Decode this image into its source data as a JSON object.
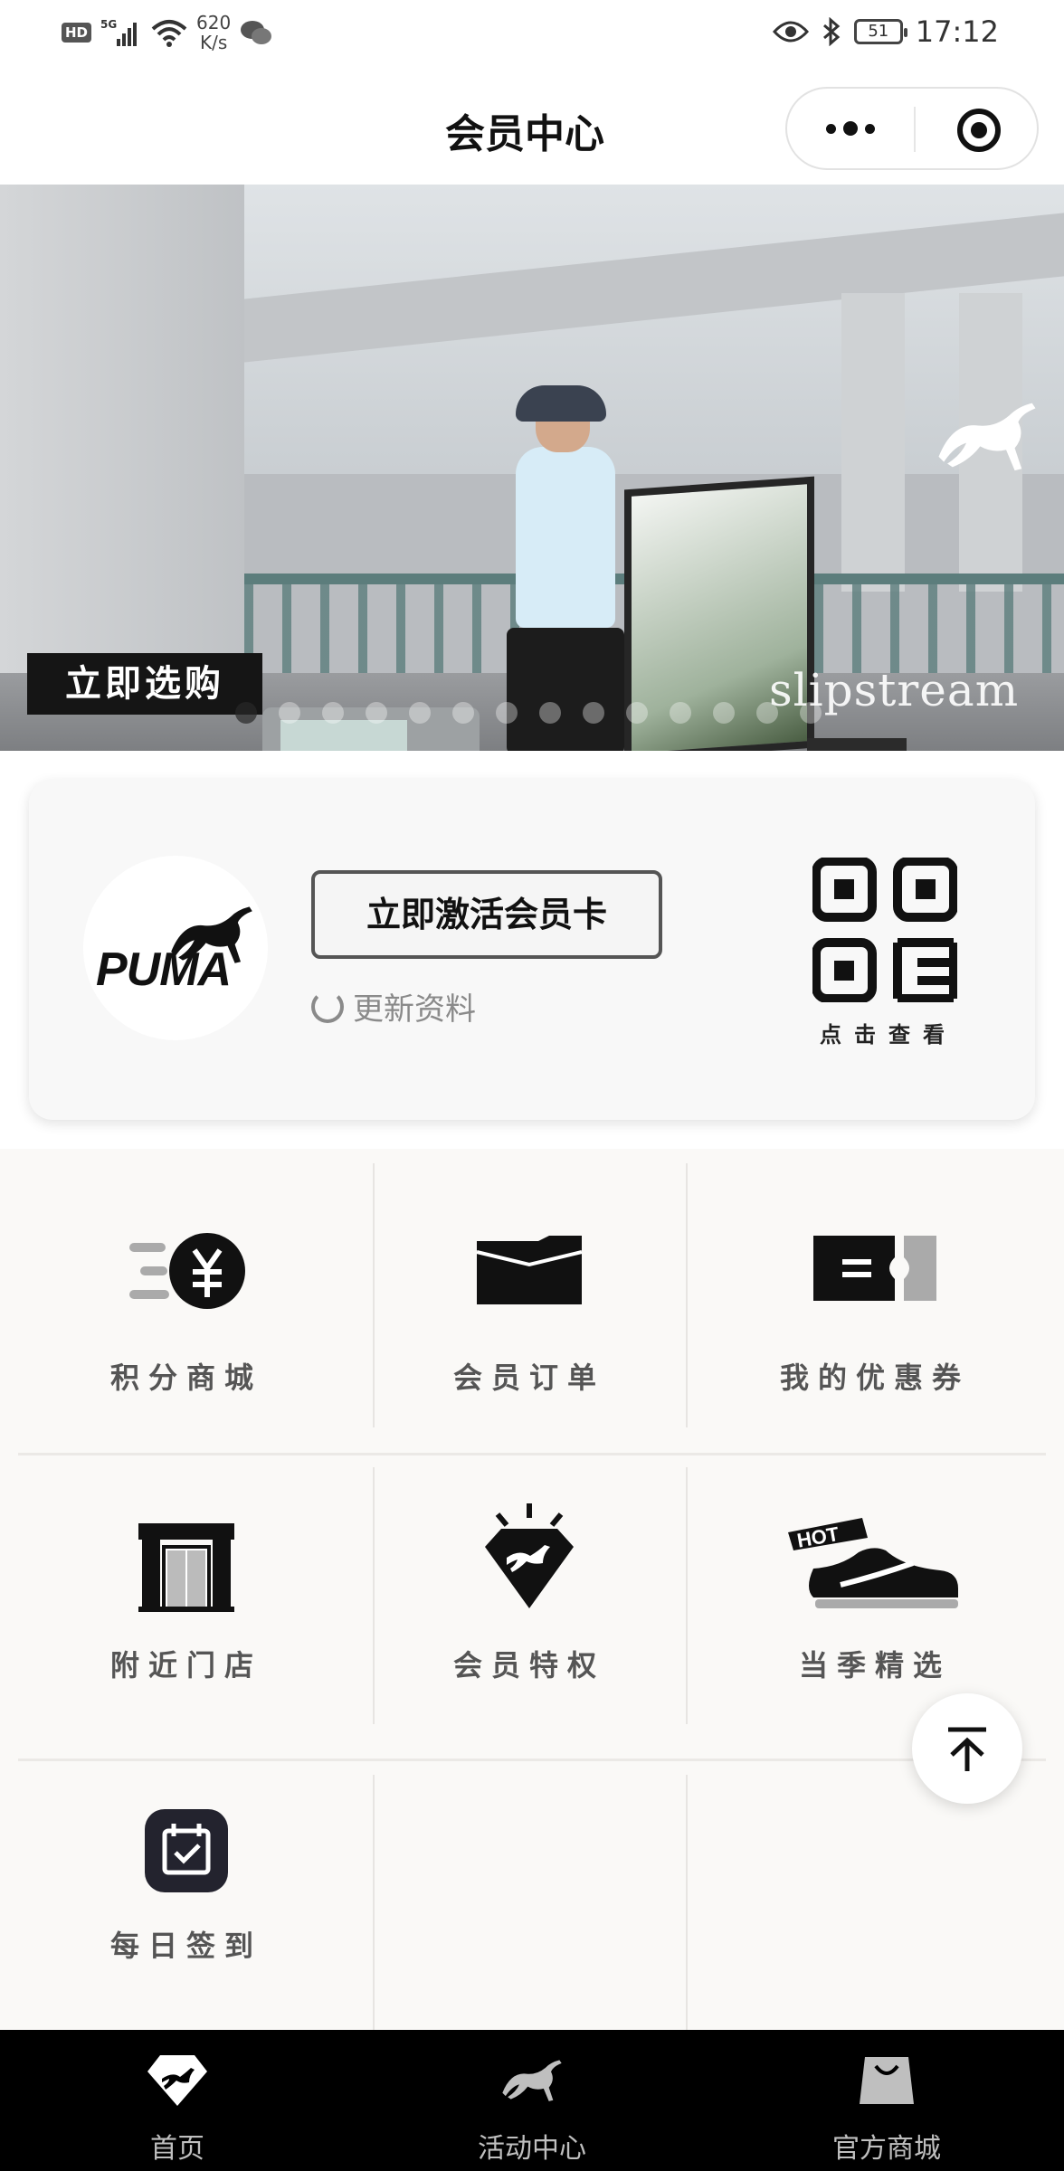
{
  "status_bar": {
    "left_badges": [
      "HD",
      "5G"
    ],
    "net_speed_value": "620",
    "net_speed_unit": "K/s",
    "battery": "51",
    "time": "17:12"
  },
  "title_bar": {
    "title": "会员中心"
  },
  "banner": {
    "shop_now": "立即选购",
    "watermark": "slipstream",
    "slide_count": 14,
    "active_slide": 0
  },
  "member_card": {
    "logo_text": "PUMA",
    "activate_label": "立即激活会员卡",
    "refresh_label": "更新资料",
    "qr_label": "点击查看"
  },
  "menu": {
    "items": [
      {
        "label": "积分商城",
        "icon": "points-mall-icon"
      },
      {
        "label": "会员订单",
        "icon": "order-folder-icon"
      },
      {
        "label": "我的优惠券",
        "icon": "coupon-icon"
      },
      {
        "label": "附近门店",
        "icon": "store-icon"
      },
      {
        "label": "会员特权",
        "icon": "diamond-privilege-icon"
      },
      {
        "label": "当季精选",
        "icon": "hot-sneaker-icon"
      },
      {
        "label": "每日签到",
        "icon": "calendar-checkin-icon"
      }
    ]
  },
  "tab_bar": {
    "tabs": [
      {
        "label": "首页",
        "icon": "home-diamond-icon",
        "active": true
      },
      {
        "label": "活动中心",
        "icon": "puma-cat-icon",
        "active": false
      },
      {
        "label": "官方商城",
        "icon": "shopping-bag-icon",
        "active": false
      }
    ]
  },
  "colors": {
    "accent": "#111111",
    "tab_bar_bg": "#000000",
    "grid_bg": "#faf9f7"
  }
}
